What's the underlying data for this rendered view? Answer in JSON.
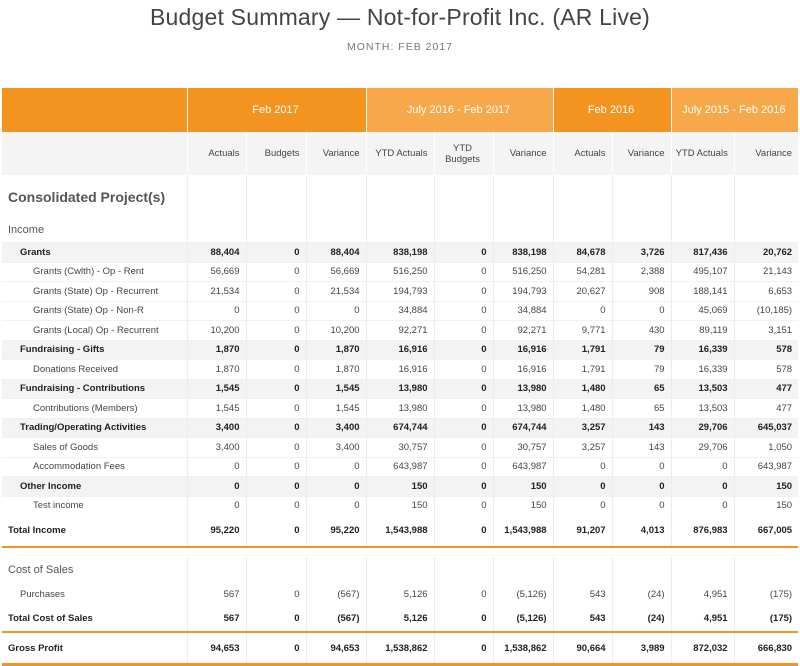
{
  "report": {
    "title": "Budget Summary — Not-for-Profit Inc. (AR Live)",
    "subtitle": "MONTH: FEB 2017"
  },
  "periods": [
    "Feb 2017",
    "July 2016 - Feb 2017",
    "Feb 2016",
    "July 2015 - Feb 2016"
  ],
  "columns": [
    "Actuals",
    "Budgets",
    "Variance",
    "YTD Actuals",
    "YTD Budgets",
    "Variance",
    "Actuals",
    "Variance",
    "YTD Actuals",
    "Variance"
  ],
  "project_title": "Consolidated Project(s)",
  "income_label": "Income",
  "income_rows": [
    {
      "kind": "group",
      "label": "Grants",
      "values": [
        "88,404",
        "0",
        "88,404",
        "838,198",
        "0",
        "838,198",
        "84,678",
        "3,726",
        "817,436",
        "20,762"
      ]
    },
    {
      "kind": "child",
      "label": "Grants (Cwlth) - Op - Rent",
      "values": [
        "56,669",
        "0",
        "56,669",
        "516,250",
        "0",
        "516,250",
        "54,281",
        "2,388",
        "495,107",
        "21,143"
      ]
    },
    {
      "kind": "child",
      "label": "Grants (State) Op - Recurrent",
      "values": [
        "21,534",
        "0",
        "21,534",
        "194,793",
        "0",
        "194,793",
        "20,627",
        "908",
        "188,141",
        "6,653"
      ]
    },
    {
      "kind": "child",
      "label": "Grants (State) Op - Non-R",
      "values": [
        "0",
        "0",
        "0",
        "34,884",
        "0",
        "34,884",
        "0",
        "0",
        "45,069",
        "(10,185)"
      ]
    },
    {
      "kind": "child",
      "label": "Grants (Local) Op - Recurrent",
      "values": [
        "10,200",
        "0",
        "10,200",
        "92,271",
        "0",
        "92,271",
        "9,771",
        "430",
        "89,119",
        "3,151"
      ]
    },
    {
      "kind": "group",
      "label": "Fundraising - Gifts",
      "values": [
        "1,870",
        "0",
        "1,870",
        "16,916",
        "0",
        "16,916",
        "1,791",
        "79",
        "16,339",
        "578"
      ]
    },
    {
      "kind": "child",
      "label": "Donations Received",
      "values": [
        "1,870",
        "0",
        "1,870",
        "16,916",
        "0",
        "16,916",
        "1,791",
        "79",
        "16,339",
        "578"
      ]
    },
    {
      "kind": "group",
      "label": "Fundraising - Contributions",
      "values": [
        "1,545",
        "0",
        "1,545",
        "13,980",
        "0",
        "13,980",
        "1,480",
        "65",
        "13,503",
        "477"
      ]
    },
    {
      "kind": "child",
      "label": "Contributions (Members)",
      "values": [
        "1,545",
        "0",
        "1,545",
        "13,980",
        "0",
        "13,980",
        "1,480",
        "65",
        "13,503",
        "477"
      ]
    },
    {
      "kind": "group",
      "label": "Trading/Operating Activities",
      "values": [
        "3,400",
        "0",
        "3,400",
        "674,744",
        "0",
        "674,744",
        "3,257",
        "143",
        "29,706",
        "645,037"
      ]
    },
    {
      "kind": "child",
      "label": "Sales of Goods",
      "values": [
        "3,400",
        "0",
        "3,400",
        "30,757",
        "0",
        "30,757",
        "3,257",
        "143",
        "29,706",
        "1,050"
      ]
    },
    {
      "kind": "child",
      "label": "Accommodation Fees",
      "values": [
        "0",
        "0",
        "0",
        "643,987",
        "0",
        "643,987",
        "0",
        "0",
        "0",
        "643,987"
      ]
    },
    {
      "kind": "group",
      "label": "Other Income",
      "values": [
        "0",
        "0",
        "0",
        "150",
        "0",
        "150",
        "0",
        "0",
        "0",
        "150"
      ]
    },
    {
      "kind": "child",
      "label": "Test income",
      "values": [
        "0",
        "0",
        "0",
        "150",
        "0",
        "150",
        "0",
        "0",
        "0",
        "150"
      ]
    }
  ],
  "total_income": {
    "label": "Total Income",
    "values": [
      "95,220",
      "0",
      "95,220",
      "1,543,988",
      "0",
      "1,543,988",
      "91,207",
      "4,013",
      "876,983",
      "667,005"
    ]
  },
  "cost_label": "Cost of Sales",
  "cost_rows": [
    {
      "label": "Purchases",
      "values": [
        "567",
        "0",
        "(567)",
        "5,126",
        "0",
        "(5,126)",
        "543",
        "(24)",
        "4,951",
        "(175)"
      ]
    }
  ],
  "total_cost": {
    "label": "Total Cost of Sales",
    "values": [
      "567",
      "0",
      "(567)",
      "5,126",
      "0",
      "(5,126)",
      "543",
      "(24)",
      "4,951",
      "(175)"
    ]
  },
  "gross_profit": {
    "label": "Gross Profit",
    "values": [
      "94,653",
      "0",
      "94,653",
      "1,538,862",
      "0",
      "1,538,862",
      "90,664",
      "3,989",
      "872,032",
      "666,830"
    ]
  },
  "colors": {
    "accent": "#f39320",
    "accent_light": "#f6a84a",
    "negative": "#d9262c"
  }
}
